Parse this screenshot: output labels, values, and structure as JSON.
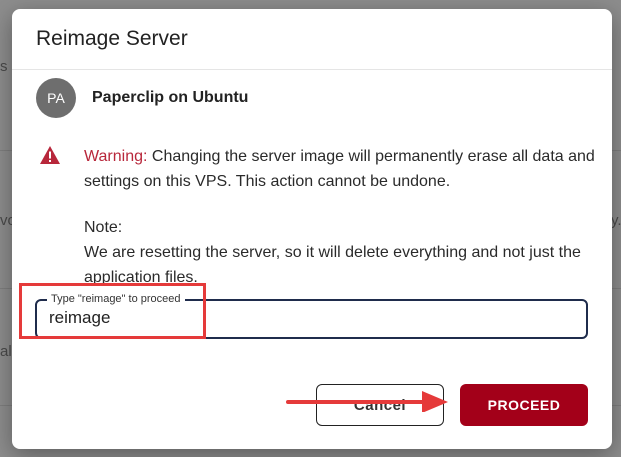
{
  "background": {
    "fragments": [
      "s r",
      "vo",
      "y.",
      "al"
    ]
  },
  "modal": {
    "title": "Reimage Server",
    "server": {
      "avatar_initials": "PA",
      "name": "Paperclip on Ubuntu"
    },
    "warning": {
      "label": "Warning:",
      "message": " Changing the server image will permanently erase all data and settings on this VPS. This action cannot be undone."
    },
    "note": {
      "heading": "Note:",
      "body": "We are resetting the server, so it will delete everything and not just the application files."
    },
    "confirm_field": {
      "label": "Type \"reimage\" to proceed",
      "value": "reimage"
    },
    "buttons": {
      "cancel": "Cancel",
      "proceed": "PROCEED"
    }
  },
  "colors": {
    "warning_red": "#b8273b",
    "proceed_bg": "#a30019",
    "annotation_red": "#e53a3a",
    "field_border": "#1f2c4c"
  },
  "icons": {
    "warning": "warning-triangle-icon"
  }
}
